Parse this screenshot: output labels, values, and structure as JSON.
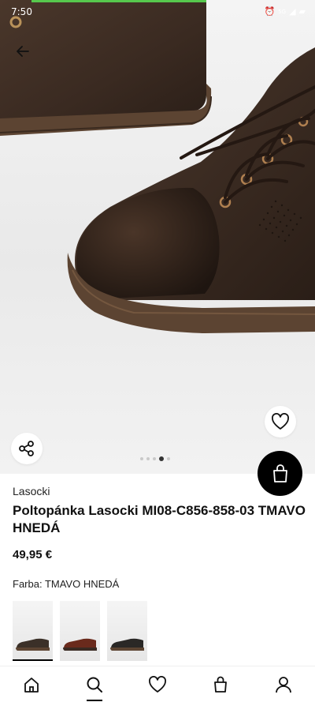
{
  "status_bar": {
    "time": "7:50",
    "network": "5G"
  },
  "gallery": {
    "dot_count": 5,
    "active_index": 3
  },
  "product": {
    "brand": "Lasocki",
    "title": "Poltopánka Lasocki MI08-C856-858-03 TMAVO HNEDÁ",
    "price": "49,95 €",
    "color_label": "Farba: TMAVO HNEDÁ"
  },
  "variants": [
    {
      "color": "#3b3028",
      "selected": true
    },
    {
      "color": "#6a2a1c",
      "selected": false
    },
    {
      "color": "#2a2826",
      "selected": false
    }
  ],
  "bottom_nav": [
    {
      "icon": "home-icon",
      "active": false
    },
    {
      "icon": "search-icon",
      "active": true
    },
    {
      "icon": "heart-icon",
      "active": false
    },
    {
      "icon": "bag-icon",
      "active": false
    },
    {
      "icon": "user-icon",
      "active": false
    }
  ],
  "colors": {
    "progress": "#57c84d",
    "accent": "#000000",
    "shoe_leather": "#3d2d24",
    "shoe_sole": "#5c4432"
  }
}
